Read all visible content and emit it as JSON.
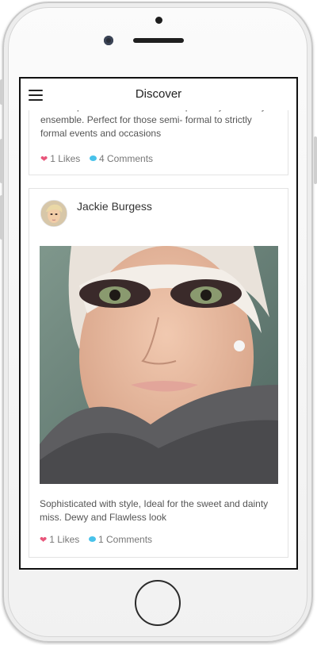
{
  "header": {
    "title": "Discover"
  },
  "cards": [
    {
      "text_cut": "Achieve perfection that would compliment your classy",
      "text": "ensemble. Perfect for those semi- formal to strictly formal events and occasions",
      "likes": "1 Likes",
      "comments": "4 Comments"
    },
    {
      "author": "Jackie Burgess",
      "text": "Sophisticated with style, Ideal for the sweet and dainty miss. Dewy and Flawless look",
      "likes": "1 Likes",
      "comments": "1 Comments"
    }
  ],
  "colors": {
    "like": "#e8557a",
    "comment": "#48c2ea",
    "frame": "#111111"
  }
}
